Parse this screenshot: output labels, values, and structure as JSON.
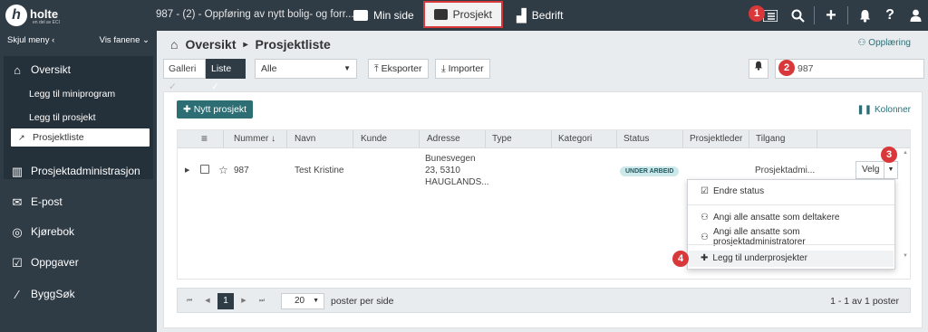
{
  "topbar": {
    "logo_word": "holte",
    "logo_letter": "h",
    "logo_tagline": "en del av ECI",
    "project_title": "987 - (2) - Oppføring av nytt bolig- og forr...",
    "tabs": [
      {
        "label": "Min side",
        "icon": "id-card-icon"
      },
      {
        "label": "Prosjekt",
        "icon": "folder-icon",
        "active": true
      },
      {
        "label": "Bedrift",
        "icon": "factory-icon"
      }
    ],
    "tools": [
      "list-icon",
      "search-icon",
      "plus-icon",
      "bell-icon",
      "help-icon",
      "user-icon"
    ],
    "help_glyph": "?",
    "plus_glyph": "+"
  },
  "markers": [
    "1",
    "2",
    "3",
    "4"
  ],
  "sidebar": {
    "hide_menu": "Skjul meny",
    "show_tabs": "Vis fanene",
    "overview": "Oversikt",
    "sub_items": [
      "Legg til miniprogram",
      "Legg til prosjekt",
      "Prosjektliste"
    ],
    "items": [
      {
        "label": "Prosjektadministrasjon",
        "icon": "building-icon"
      },
      {
        "label": "E-post",
        "icon": "envelope-icon"
      },
      {
        "label": "Kjørebok",
        "icon": "steering-wheel-icon"
      },
      {
        "label": "Oppgaver",
        "icon": "clipboard-check-icon"
      },
      {
        "label": "ByggSøk",
        "icon": "magic-wand-icon"
      }
    ]
  },
  "main": {
    "breadcrumb_root": "Oversikt",
    "breadcrumb_current": "Prosjektliste",
    "training": "Opplæring",
    "view_gallery": "Galleri",
    "view_list": "Liste",
    "filter_value": "Alle",
    "export": "Eksporter",
    "import": "Importer",
    "search_value": "987",
    "new_project": "Nytt prosjekt",
    "columns": "Kolonner"
  },
  "table": {
    "headers": [
      "Nummer",
      "Navn",
      "Kunde",
      "Adresse",
      "Type",
      "Kategori",
      "Status",
      "Prosjektleder",
      "Tilgang"
    ],
    "sort_indicator": "↓",
    "row": {
      "number": "987",
      "name": "Test Kristine",
      "address_1": "Bunesvegen",
      "address_2": "23, 5310",
      "address_3": "HAUGLANDS...",
      "status": "UNDER ARBEID",
      "access": "Prosjektadmi...",
      "action": "Velg"
    }
  },
  "menu": {
    "change_status": "Endre status",
    "all_participants": "Angi alle ansatte som deltakere",
    "all_admins": "Angi alle ansatte som prosjektadministratorer",
    "add_subprojects": "Legg til underprosjekter"
  },
  "pager": {
    "current_page": "1",
    "per_page": "20",
    "per_page_label": "poster per side",
    "count": "1 - 1 av 1 poster"
  },
  "colors": {
    "dark": "#2f3b45",
    "accent": "#2c6e74",
    "marker": "#d9383a"
  }
}
